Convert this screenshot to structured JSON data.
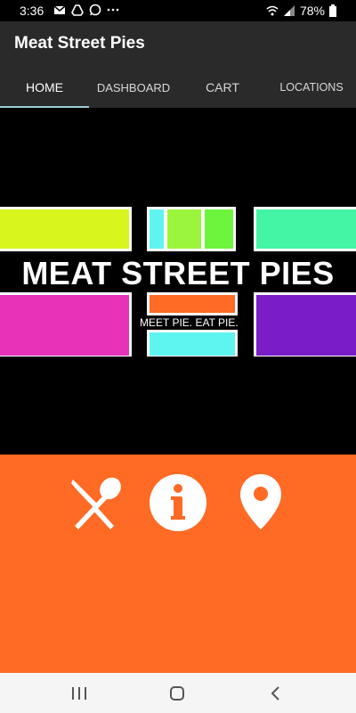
{
  "status": {
    "time": "3:36",
    "battery": "78%",
    "left_icons": [
      "gmail-icon",
      "drive-icon",
      "whatsapp-icon",
      "more-dots-icon"
    ],
    "right_icons": [
      "wifi-icon",
      "signal-icon",
      "battery-icon"
    ]
  },
  "app": {
    "title": "Meat Street Pies"
  },
  "tabs": [
    {
      "label": "HOME",
      "active": true
    },
    {
      "label": "DASHBOARD",
      "active": false
    },
    {
      "label": "CART",
      "active": false
    },
    {
      "label": "LOCATIONS",
      "active": false
    }
  ],
  "banner": {
    "title": "MEAT STREET PIES",
    "tagline": "MEET PIE. EAT PIE.",
    "colors": {
      "lime": "#d8f51e",
      "cyan": "#5ef5f0",
      "green_light": "#9bf53c",
      "green": "#6cf53c",
      "mint": "#44f5a5",
      "magenta": "#e832b8",
      "orange": "#ff6a25",
      "purple": "#7a1cc8"
    }
  },
  "actions": [
    {
      "icon": "utensils-icon",
      "name": "menu-button"
    },
    {
      "icon": "info-icon",
      "name": "info-button"
    },
    {
      "icon": "location-pin-icon",
      "name": "locations-button"
    }
  ],
  "colors": {
    "accent": "#ff6a25",
    "app_bar": "#2a2a2a",
    "tab_indicator": "#9ad0d8"
  }
}
